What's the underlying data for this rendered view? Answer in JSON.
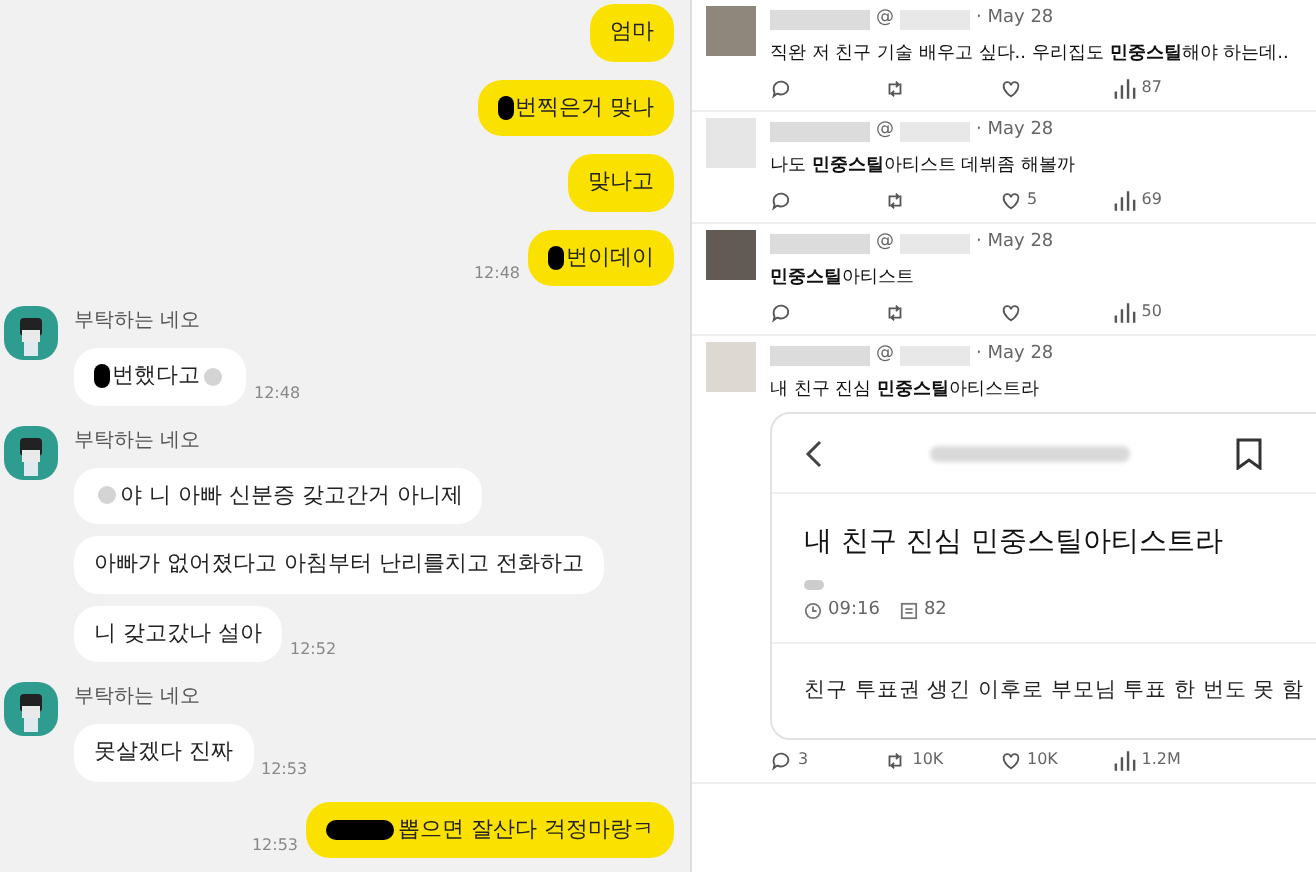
{
  "chat": {
    "groups": [
      {
        "kind": "sent",
        "bubbles": [
          {
            "text": "엄마"
          },
          {
            "text": "번찍은거 맞나",
            "blacked_out": true
          },
          {
            "text": "맞나고"
          },
          {
            "text": "번이데이",
            "blacked_out": true,
            "time": "12:48"
          }
        ]
      },
      {
        "kind": "received",
        "sender": "부탁하는 네오",
        "bubbles": [
          {
            "text": "번했다고",
            "blacked_out": true,
            "blurred_end": true,
            "time": "12:48"
          }
        ]
      },
      {
        "kind": "received",
        "sender": "부탁하는 네오",
        "bubbles": [
          {
            "text": "야 니 아빠 신분증 갖고간거 아니제",
            "blurred_start": true
          },
          {
            "text": "아빠가 없어졌다고 아침부터 난리를치고 전화하고"
          },
          {
            "text": "니 갖고갔나 설아",
            "time": "12:52"
          }
        ]
      },
      {
        "kind": "received",
        "sender": "부탁하는 네오",
        "bubbles": [
          {
            "text": "못살겠다 진짜",
            "time": "12:53"
          }
        ]
      },
      {
        "kind": "sent",
        "bubbles": [
          {
            "text": "뽑으면 잘산다 걱정마랑ㅋ",
            "blacked_out_word": true,
            "time": "12:53"
          }
        ]
      }
    ]
  },
  "feed": {
    "tweets": [
      {
        "handle": "@",
        "date": "· May 28",
        "text": "직완 저 친구 기술 배우고 싶다.. 우리집도 **민중스틸**해야 하는데..",
        "actions": [
          {
            "kind": "reply"
          },
          {
            "kind": "retweet"
          },
          {
            "kind": "like"
          },
          {
            "kind": "views",
            "count": "87"
          }
        ]
      },
      {
        "handle": "@",
        "date": "· May 28",
        "text": "나도 **민중스틸**아티스트 데뷔좀 해볼까",
        "actions": [
          {
            "kind": "reply"
          },
          {
            "kind": "retweet"
          },
          {
            "kind": "like",
            "count": "5"
          },
          {
            "kind": "views",
            "count": "69"
          }
        ]
      },
      {
        "handle": "@",
        "date": "· May 28",
        "text": "**민중스틸**아티스트",
        "actions": [
          {
            "kind": "reply"
          },
          {
            "kind": "retweet"
          },
          {
            "kind": "like"
          },
          {
            "kind": "views",
            "count": "50"
          }
        ]
      },
      {
        "handle": "@",
        "date": "· May 28",
        "text": "내 친구 진심 **민중스틸**아티스트라",
        "card": {
          "title": "내 친구 진심 민중스틸아티스트라",
          "time": "09:16",
          "comments": "82",
          "body": "친구 투표권 생긴 이후로 부모님 투표 한 번도 못 함"
        },
        "actions": [
          {
            "kind": "reply",
            "count": "3"
          },
          {
            "kind": "retweet",
            "count": "10K"
          },
          {
            "kind": "like",
            "count": "10K"
          },
          {
            "kind": "views",
            "count": "1.2M"
          }
        ]
      }
    ]
  }
}
